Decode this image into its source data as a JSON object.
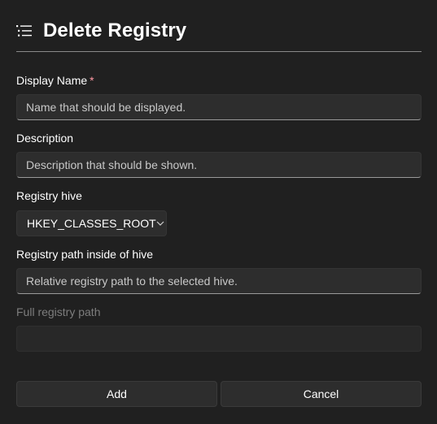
{
  "header": {
    "title": "Delete Registry",
    "icon": "list-icon"
  },
  "form": {
    "display_name": {
      "label": "Display Name",
      "required_marker": "*",
      "placeholder": "Name that should be displayed."
    },
    "description": {
      "label": "Description",
      "placeholder": "Description that should be shown."
    },
    "registry_hive": {
      "label": "Registry hive",
      "selected": "HKEY_CLASSES_ROOT",
      "icon": "chevron-down-icon"
    },
    "registry_path": {
      "label": "Registry path inside of hive",
      "placeholder": "Relative registry path to the selected hive."
    },
    "full_path": {
      "label": "Full registry path",
      "value": ""
    }
  },
  "actions": {
    "add_label": "Add",
    "cancel_label": "Cancel"
  },
  "colors": {
    "background": "#202020",
    "required": "#ff99a4",
    "field": "#2d2d2d"
  }
}
